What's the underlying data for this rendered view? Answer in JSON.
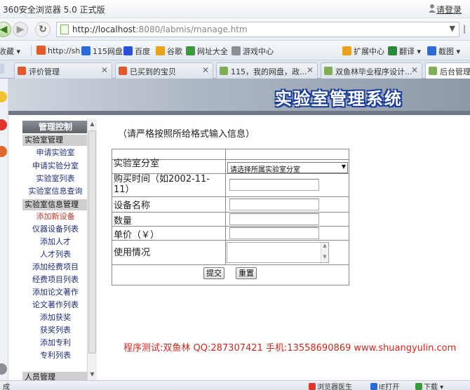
{
  "browser": {
    "title": "360安全浏览器 5.0 正式版",
    "login": "请登录",
    "url_host": "http://localhost",
    "url_rest": ":8080/labmis/manage.htm"
  },
  "bookmarks": [
    "收藏",
    "http://sh",
    "115网盘",
    "百度",
    "谷歌",
    "网址大全",
    "游戏中心",
    "扩展中心",
    "翻译",
    "截图"
  ],
  "tabs": [
    {
      "label": "评价管理",
      "color": "#e05a2b"
    },
    {
      "label": "已买到的宝贝",
      "color": "#e05a2b"
    },
    {
      "label": "115，我的网盘，政...",
      "color": "#7fae55"
    },
    {
      "label": "双鱼林毕业程序设计...",
      "color": "#7fae55"
    },
    {
      "label": "后台管理",
      "color": "#7fae55"
    }
  ],
  "banner": {
    "title": "实验室管理系统"
  },
  "menu": {
    "header": "管理控制",
    "section1": "实验室管理",
    "section1_items": [
      "申请实验室",
      "申请实验分室",
      "实验室列表",
      "实验室信息查询"
    ],
    "section2": "实验室信息管理",
    "section2_items": [
      "添加新设备",
      "仪器设备列表",
      "添加人才",
      "人才列表",
      "添加经费项目",
      "经费项目列表",
      "添加论文著作",
      "论文著作列表",
      "添加获奖",
      "获奖列表",
      "添加专利",
      "专利列表"
    ],
    "section3": "人员管理"
  },
  "form": {
    "hint": "（请严格按照所给格式输入信息）",
    "labels": {
      "lab_branch": "实验室分室",
      "purchase_time": "购买时间（如2002-11-11）",
      "device_name": "设备名称",
      "quantity": "数量",
      "unit_price": "单价（￥）",
      "usage": "使用情况"
    },
    "branch_select": "请选择所属实验室分室",
    "submit": "提交",
    "reset": "重置"
  },
  "footer": "程序测试:双鱼林 QQ:287307421 手机:13558690869 www.shuangyulin.com",
  "status": {
    "doctor": "浏览器医生",
    "ie_open": "IE打开",
    "download": "下载"
  }
}
